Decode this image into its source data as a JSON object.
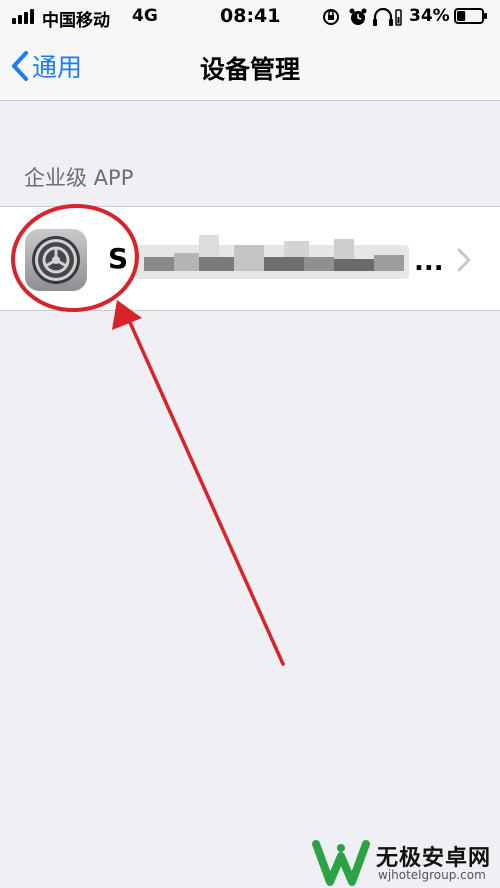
{
  "status_bar": {
    "carrier": "中国移动",
    "network": "4G",
    "time": "08:41",
    "battery_percent": "34%",
    "battery_level": 0.34,
    "icons": [
      "signal-icon",
      "orientation-lock-icon",
      "alarm-icon",
      "headphones-icon",
      "battery-icon"
    ]
  },
  "nav": {
    "back_label": "通用",
    "title": "设备管理"
  },
  "section": {
    "header": "企业级 APP",
    "items": [
      {
        "name": "S",
        "name_suffix": "...",
        "icon": "settings-gear-icon",
        "accessory": "chevron-right-icon"
      }
    ]
  },
  "watermark": {
    "text": "无极安卓网",
    "url": "wjhotelgroup.com"
  },
  "colors": {
    "accent": "#1a7dfc",
    "background": "#efeff4",
    "annotation": "#d9232a"
  }
}
